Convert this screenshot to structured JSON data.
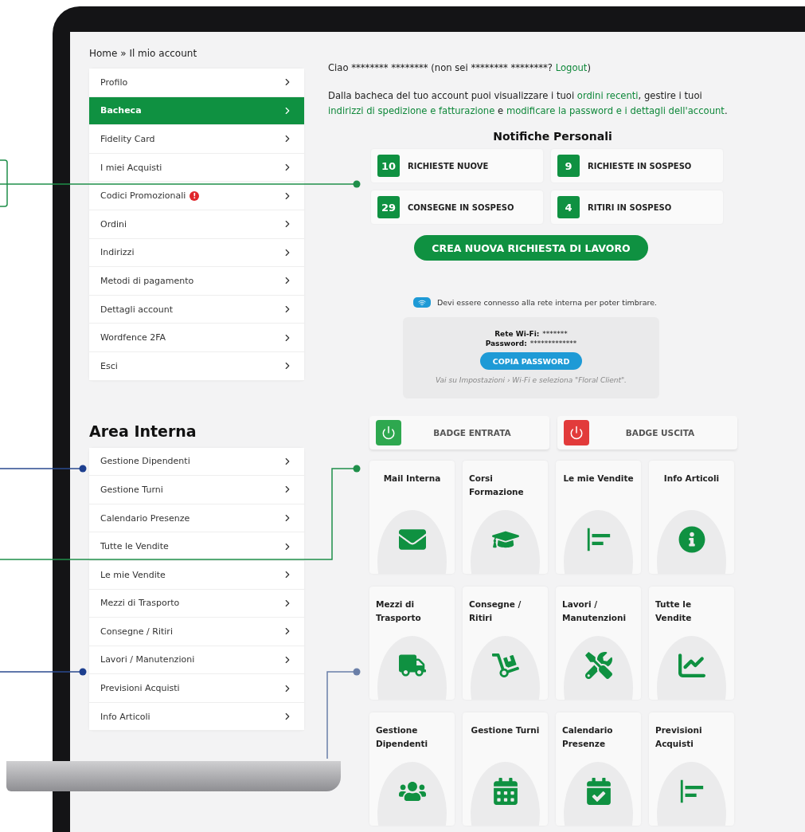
{
  "breadcrumb": "Home » Il mio account",
  "account_menu": [
    {
      "label": "Profilo",
      "selected": false
    },
    {
      "label": "Bacheca",
      "selected": true
    },
    {
      "label": "Fidelity Card",
      "selected": false
    },
    {
      "label": "I miei Acquisti",
      "selected": false
    },
    {
      "label": "Codici Promozionali",
      "selected": false,
      "badge": "!"
    },
    {
      "label": "Ordini",
      "selected": false
    },
    {
      "label": "Indirizzi",
      "selected": false
    },
    {
      "label": "Metodi di pagamento",
      "selected": false
    },
    {
      "label": "Dettagli account",
      "selected": false
    },
    {
      "label": "Wordfence 2FA",
      "selected": false
    },
    {
      "label": "Esci",
      "selected": false
    }
  ],
  "internal_area": {
    "title": "Area Interna",
    "items": [
      {
        "label": "Gestione Dipendenti",
        "selected": false
      },
      {
        "label": "Gestione Turni",
        "selected": false
      },
      {
        "label": "Calendario Presenze",
        "selected": false
      },
      {
        "label": "Tutte le Vendite",
        "selected": false
      },
      {
        "label": "Le mie Vendite",
        "selected": false
      },
      {
        "label": "Mezzi di Trasporto",
        "selected": false
      },
      {
        "label": "Consegne / Ritiri",
        "selected": false
      },
      {
        "label": "Lavori / Manutenzioni",
        "selected": false
      },
      {
        "label": "Previsioni Acquisti",
        "selected": false
      },
      {
        "label": "Info Articoli",
        "selected": false
      }
    ]
  },
  "greeting": [
    {
      "text": "Ciao ******** ******** (non sei ******** ********? ",
      "link": false
    },
    {
      "text": "Logout",
      "link": true
    },
    {
      "text": ")",
      "link": false
    }
  ],
  "intro": [
    {
      "text": "Dalla bacheca del tuo account puoi visualizzare i tuoi ",
      "link": false
    },
    {
      "text": "ordini recenti",
      "link": true
    },
    {
      "text": ", gestire i tuoi ",
      "link": false
    },
    {
      "text": "indirizzi di spedizione e fatturazione",
      "link": true
    },
    {
      "text": " e ",
      "link": false
    },
    {
      "text": "modificare la password e i dettagli dell'account",
      "link": true
    },
    {
      "text": ".",
      "link": false
    }
  ],
  "notifications": {
    "title": "Notifiche Personali",
    "items": [
      {
        "count": "10",
        "label": "RICHIESTE NUOVE"
      },
      {
        "count": "9",
        "label": "RICHIESTE IN SOSPESO"
      },
      {
        "count": "29",
        "label": "CONSEGNE IN SOSPESO"
      },
      {
        "count": "4",
        "label": "RITIRI IN SOSPESO"
      }
    ]
  },
  "new_request_button": "CREA NUOVA RICHIESTA DI LAVORO",
  "wifi_notice": "Devi essere connesso alla rete interna per poter timbrare.",
  "wifi_box": {
    "network_label": "Rete Wi-Fi:",
    "network_value": "*******",
    "password_label": "Password:",
    "password_value": "*************",
    "copy_button": "COPIA PASSWORD",
    "hint": "Vai su Impostazioni  ›  Wi-Fi e seleziona \"Floral Client\"."
  },
  "badges": [
    {
      "label": "BADGE ENTRATA",
      "kind": "in"
    },
    {
      "label": "BADGE USCITA",
      "kind": "out"
    }
  ],
  "tiles": [
    {
      "label": "Mail Interna",
      "centered": true
    },
    {
      "label": "Corsi Formazione",
      "centered": false
    },
    {
      "label": "Le mie Vendite",
      "centered": true
    },
    {
      "label": "Info Articoli",
      "centered": true
    },
    {
      "label": "Mezzi di Trasporto",
      "centered": false
    },
    {
      "label": "Consegne / Ritiri",
      "centered": false
    },
    {
      "label": "Lavori / Manutenzioni",
      "centered": false
    },
    {
      "label": "Tutte le Vendite",
      "centered": false
    },
    {
      "label": "Gestione Dipendenti",
      "centered": false
    },
    {
      "label": "Gestione Turni",
      "centered": true
    },
    {
      "label": "Calendario Presenze",
      "centered": false
    },
    {
      "label": "Previsioni Acquisti",
      "centered": false
    }
  ]
}
